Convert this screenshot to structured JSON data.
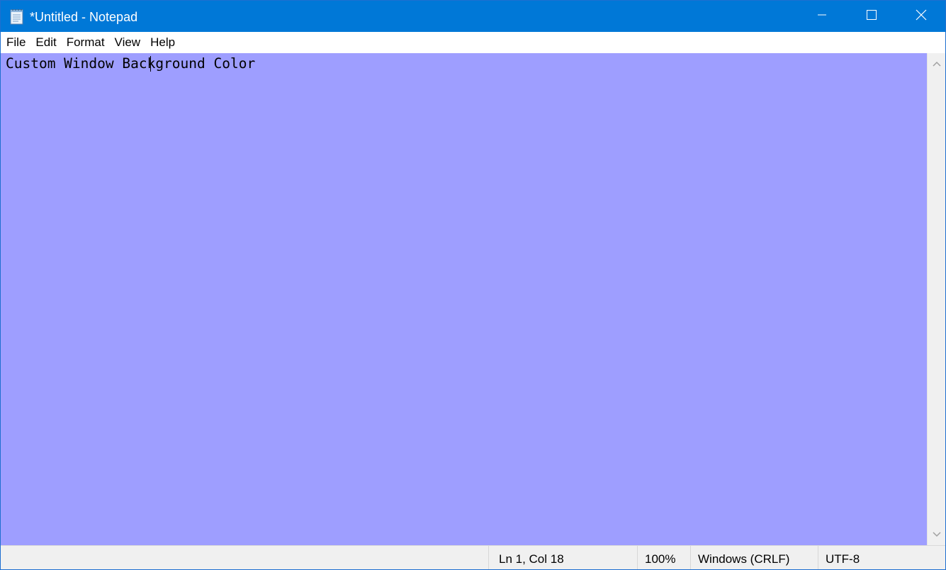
{
  "window": {
    "title": "*Untitled - Notepad",
    "app_icon": "notepad-icon"
  },
  "caption_buttons": {
    "minimize_icon": "minimize-icon",
    "maximize_icon": "maximize-icon",
    "close_icon": "close-icon"
  },
  "menu": {
    "items": [
      {
        "label": "File"
      },
      {
        "label": "Edit"
      },
      {
        "label": "Format"
      },
      {
        "label": "View"
      },
      {
        "label": "Help"
      }
    ]
  },
  "editor": {
    "text": "Custom Window Background Color",
    "background_color": "#9e9eff"
  },
  "scrollbar": {
    "up_icon": "scroll-up-arrow-icon",
    "down_icon": "scroll-down-arrow-icon"
  },
  "status": {
    "position": "Ln 1, Col 18",
    "zoom": "100%",
    "line_ending": "Windows (CRLF)",
    "encoding": "UTF-8"
  },
  "colors": {
    "titlebar": "#0078d7",
    "editor_bg": "#9e9eff",
    "statusbar_bg": "#f0f0f0"
  }
}
